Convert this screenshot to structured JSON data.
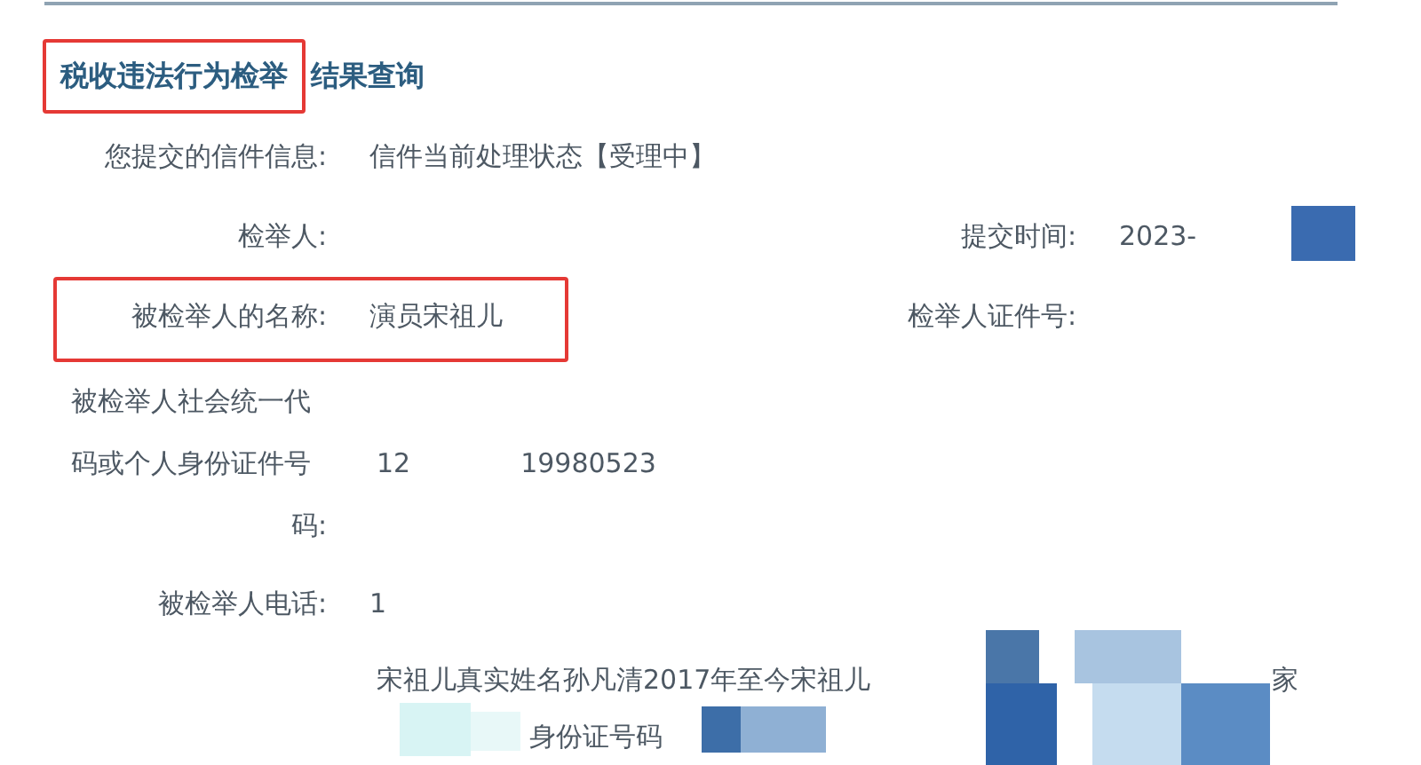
{
  "title": {
    "highlighted": "税收违法行为检举",
    "rest": "结果查询"
  },
  "rows": [
    {
      "label": "您提交的信件信息:",
      "value": "信件当前处理状态【受理中】",
      "highlighted": false
    },
    {
      "label": "检举人:",
      "value": "",
      "right_label": "提交时间:",
      "right_value": "2023-",
      "highlighted": false
    },
    {
      "label": "被检举人的名称:",
      "value": "演员宋祖儿",
      "right_label": "检举人证件号:",
      "highlighted": true
    }
  ],
  "id_label": [
    "被检举人社会统一代",
    "码或个人身份证件号",
    "码:"
  ],
  "id_value": [
    "12",
    "19980523"
  ],
  "phone": {
    "label": "被检举人电话:",
    "value": "1"
  },
  "description": [
    "宋祖儿真实姓名孙凡清2017年至今宋祖儿",
    "家",
    "身份证号码"
  ]
}
